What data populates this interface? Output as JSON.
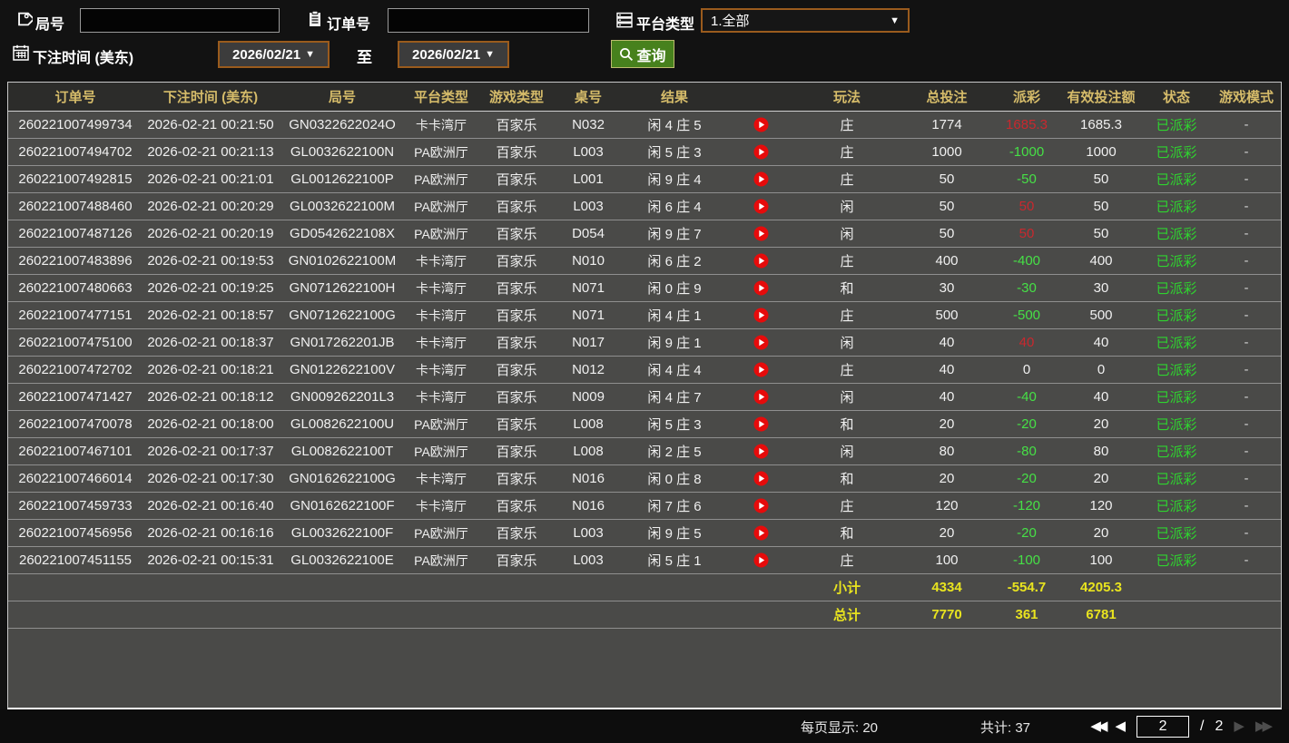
{
  "filters": {
    "game_no_label": "局号",
    "order_no_label": "订单号",
    "game_no_value": "",
    "order_no_value": "",
    "platform_label": "平台类型",
    "platform_value": "1.全部",
    "bet_time_label": "下注时间 (美东)",
    "date_from": "2026/02/21",
    "to_label": "至",
    "date_to": "2026/02/21",
    "search_label": "查询"
  },
  "icons": {
    "game_no": "tag-icon",
    "order_no": "clipboard-icon",
    "platform": "server-icon",
    "bet_time": "calendar-icon",
    "search": "magnifier-icon",
    "result_replay": "play-icon"
  },
  "table": {
    "headers": [
      "订单号",
      "下注时间 (美东)",
      "局号",
      "平台类型",
      "游戏类型",
      "桌号",
      "结果",
      "玩法",
      "总投注",
      "派彩",
      "有效投注额",
      "状态",
      "游戏模式"
    ],
    "rows": [
      {
        "order": "260221007499734",
        "time": "2026-02-21 00:21:50",
        "game_no": "GN0322622024O",
        "platform": "卡卡湾厅",
        "game_type": "百家乐",
        "table_no": "N032",
        "result": "闲 4 庄 5",
        "play_type": "庄",
        "total_bet": "1774",
        "payout": "1685.3",
        "payout_class": "pos",
        "valid_bet": "1685.3",
        "status": "已派彩",
        "mode": "-"
      },
      {
        "order": "260221007494702",
        "time": "2026-02-21 00:21:13",
        "game_no": "GL0032622100N",
        "platform": "PA欧洲厅",
        "game_type": "百家乐",
        "table_no": "L003",
        "result": "闲 5 庄 3",
        "play_type": "庄",
        "total_bet": "1000",
        "payout": "-1000",
        "payout_class": "neg",
        "valid_bet": "1000",
        "status": "已派彩",
        "mode": "-"
      },
      {
        "order": "260221007492815",
        "time": "2026-02-21 00:21:01",
        "game_no": "GL0012622100P",
        "platform": "PA欧洲厅",
        "game_type": "百家乐",
        "table_no": "L001",
        "result": "闲 9 庄 4",
        "play_type": "庄",
        "total_bet": "50",
        "payout": "-50",
        "payout_class": "neg",
        "valid_bet": "50",
        "status": "已派彩",
        "mode": "-"
      },
      {
        "order": "260221007488460",
        "time": "2026-02-21 00:20:29",
        "game_no": "GL0032622100M",
        "platform": "PA欧洲厅",
        "game_type": "百家乐",
        "table_no": "L003",
        "result": "闲 6 庄 4",
        "play_type": "闲",
        "total_bet": "50",
        "payout": "50",
        "payout_class": "pos",
        "valid_bet": "50",
        "status": "已派彩",
        "mode": "-"
      },
      {
        "order": "260221007487126",
        "time": "2026-02-21 00:20:19",
        "game_no": "GD0542622108X",
        "platform": "PA欧洲厅",
        "game_type": "百家乐",
        "table_no": "D054",
        "result": "闲 9 庄 7",
        "play_type": "闲",
        "total_bet": "50",
        "payout": "50",
        "payout_class": "pos",
        "valid_bet": "50",
        "status": "已派彩",
        "mode": "-"
      },
      {
        "order": "260221007483896",
        "time": "2026-02-21 00:19:53",
        "game_no": "GN0102622100M",
        "platform": "卡卡湾厅",
        "game_type": "百家乐",
        "table_no": "N010",
        "result": "闲 6 庄 2",
        "play_type": "庄",
        "total_bet": "400",
        "payout": "-400",
        "payout_class": "neg",
        "valid_bet": "400",
        "status": "已派彩",
        "mode": "-"
      },
      {
        "order": "260221007480663",
        "time": "2026-02-21 00:19:25",
        "game_no": "GN0712622100H",
        "platform": "卡卡湾厅",
        "game_type": "百家乐",
        "table_no": "N071",
        "result": "闲 0 庄 9",
        "play_type": "和",
        "total_bet": "30",
        "payout": "-30",
        "payout_class": "neg",
        "valid_bet": "30",
        "status": "已派彩",
        "mode": "-"
      },
      {
        "order": "260221007477151",
        "time": "2026-02-21 00:18:57",
        "game_no": "GN0712622100G",
        "platform": "卡卡湾厅",
        "game_type": "百家乐",
        "table_no": "N071",
        "result": "闲 4 庄 1",
        "play_type": "庄",
        "total_bet": "500",
        "payout": "-500",
        "payout_class": "neg",
        "valid_bet": "500",
        "status": "已派彩",
        "mode": "-"
      },
      {
        "order": "260221007475100",
        "time": "2026-02-21 00:18:37",
        "game_no": "GN017262201JB",
        "platform": "卡卡湾厅",
        "game_type": "百家乐",
        "table_no": "N017",
        "result": "闲 9 庄 1",
        "play_type": "闲",
        "total_bet": "40",
        "payout": "40",
        "payout_class": "pos",
        "valid_bet": "40",
        "status": "已派彩",
        "mode": "-"
      },
      {
        "order": "260221007472702",
        "time": "2026-02-21 00:18:21",
        "game_no": "GN0122622100V",
        "platform": "卡卡湾厅",
        "game_type": "百家乐",
        "table_no": "N012",
        "result": "闲 4 庄 4",
        "play_type": "庄",
        "total_bet": "40",
        "payout": "0",
        "payout_class": "zero",
        "valid_bet": "0",
        "status": "已派彩",
        "mode": "-"
      },
      {
        "order": "260221007471427",
        "time": "2026-02-21 00:18:12",
        "game_no": "GN009262201L3",
        "platform": "卡卡湾厅",
        "game_type": "百家乐",
        "table_no": "N009",
        "result": "闲 4 庄 7",
        "play_type": "闲",
        "total_bet": "40",
        "payout": "-40",
        "payout_class": "neg",
        "valid_bet": "40",
        "status": "已派彩",
        "mode": "-"
      },
      {
        "order": "260221007470078",
        "time": "2026-02-21 00:18:00",
        "game_no": "GL0082622100U",
        "platform": "PA欧洲厅",
        "game_type": "百家乐",
        "table_no": "L008",
        "result": "闲 5 庄 3",
        "play_type": "和",
        "total_bet": "20",
        "payout": "-20",
        "payout_class": "neg",
        "valid_bet": "20",
        "status": "已派彩",
        "mode": "-"
      },
      {
        "order": "260221007467101",
        "time": "2026-02-21 00:17:37",
        "game_no": "GL0082622100T",
        "platform": "PA欧洲厅",
        "game_type": "百家乐",
        "table_no": "L008",
        "result": "闲 2 庄 5",
        "play_type": "闲",
        "total_bet": "80",
        "payout": "-80",
        "payout_class": "neg",
        "valid_bet": "80",
        "status": "已派彩",
        "mode": "-"
      },
      {
        "order": "260221007466014",
        "time": "2026-02-21 00:17:30",
        "game_no": "GN0162622100G",
        "platform": "卡卡湾厅",
        "game_type": "百家乐",
        "table_no": "N016",
        "result": "闲 0 庄 8",
        "play_type": "和",
        "total_bet": "20",
        "payout": "-20",
        "payout_class": "neg",
        "valid_bet": "20",
        "status": "已派彩",
        "mode": "-"
      },
      {
        "order": "260221007459733",
        "time": "2026-02-21 00:16:40",
        "game_no": "GN0162622100F",
        "platform": "卡卡湾厅",
        "game_type": "百家乐",
        "table_no": "N016",
        "result": "闲 7 庄 6",
        "play_type": "庄",
        "total_bet": "120",
        "payout": "-120",
        "payout_class": "neg",
        "valid_bet": "120",
        "status": "已派彩",
        "mode": "-"
      },
      {
        "order": "260221007456956",
        "time": "2026-02-21 00:16:16",
        "game_no": "GL0032622100F",
        "platform": "PA欧洲厅",
        "game_type": "百家乐",
        "table_no": "L003",
        "result": "闲 9 庄 5",
        "play_type": "和",
        "total_bet": "20",
        "payout": "-20",
        "payout_class": "neg",
        "valid_bet": "20",
        "status": "已派彩",
        "mode": "-"
      },
      {
        "order": "260221007451155",
        "time": "2026-02-21 00:15:31",
        "game_no": "GL0032622100E",
        "platform": "PA欧洲厅",
        "game_type": "百家乐",
        "table_no": "L003",
        "result": "闲 5 庄 1",
        "play_type": "庄",
        "total_bet": "100",
        "payout": "-100",
        "payout_class": "neg",
        "valid_bet": "100",
        "status": "已派彩",
        "mode": "-"
      }
    ],
    "subtotal": {
      "label": "小计",
      "total_bet": "4334",
      "payout": "-554.7",
      "valid_bet": "4205.3"
    },
    "total": {
      "label": "总计",
      "total_bet": "7770",
      "payout": "361",
      "valid_bet": "6781"
    }
  },
  "footer": {
    "per_page_label": "每页显示: 20",
    "total_count_label": "共计: 37",
    "page_current": "2",
    "page_separator": "/",
    "page_total": "2"
  },
  "colors": {
    "header_text": "#d6bc6a",
    "payout_win": "#c9282e",
    "payout_loss": "#46e046",
    "status_paid": "#2fd32f",
    "summary": "#e9e41f",
    "search_button": "#47811d",
    "date_border": "#9a5b1d",
    "row_bg": "#4a4a48"
  }
}
